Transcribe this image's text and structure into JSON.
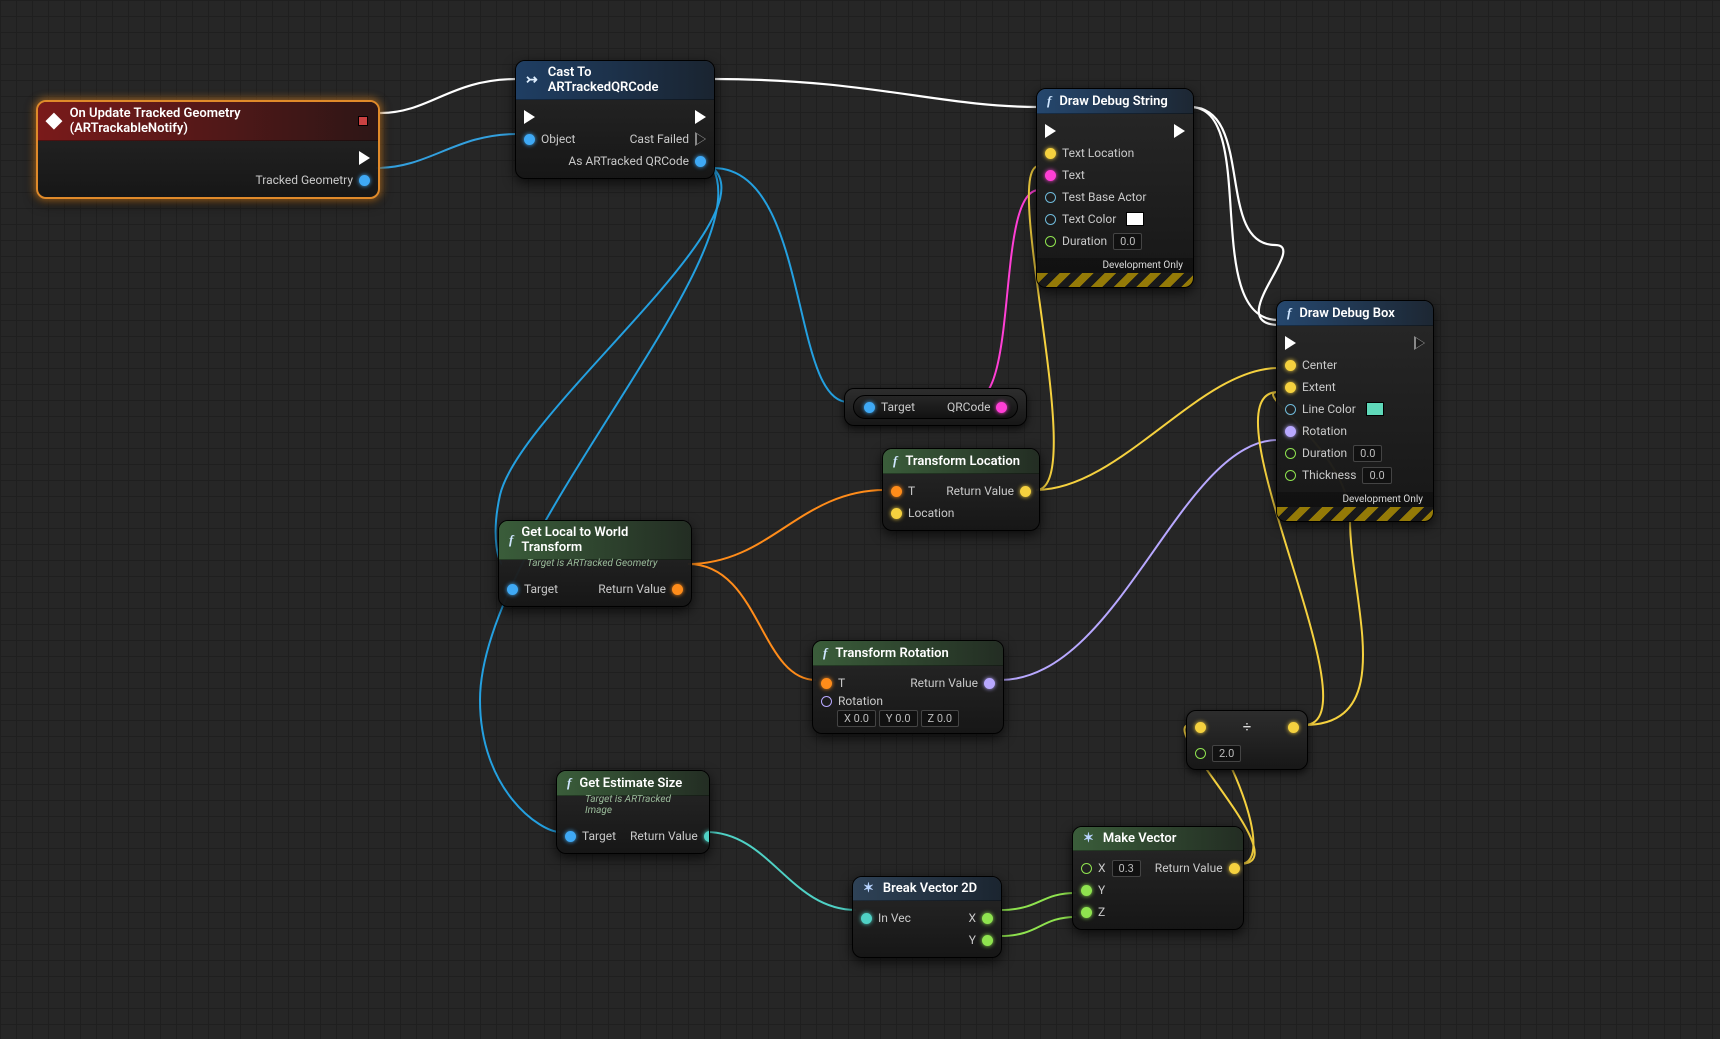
{
  "nodes": {
    "event": {
      "title": "On Update Tracked Geometry (ARTrackableNotify)",
      "out_geom": "Tracked Geometry"
    },
    "cast": {
      "title": "Cast To ARTrackedQRCode",
      "in_object": "Object",
      "out_fail": "Cast Failed",
      "out_as": "As ARTracked QRCode"
    },
    "drawString": {
      "title": "Draw Debug String",
      "in_textloc": "Text Location",
      "in_text": "Text",
      "in_testbase": "Test Base Actor",
      "in_textcolor": "Text Color",
      "in_duration": "Duration",
      "dur_val": "0.0",
      "dev": "Development Only"
    },
    "drawBox": {
      "title": "Draw Debug Box",
      "in_center": "Center",
      "in_extent": "Extent",
      "in_linecolor": "Line Color",
      "in_rotation": "Rotation",
      "in_duration": "Duration",
      "dur_val": "0.0",
      "in_thickness": "Thickness",
      "thick_val": "0.0",
      "dev": "Development Only"
    },
    "qrcode": {
      "in": "Target",
      "out": "QRCode"
    },
    "transLoc": {
      "title": "Transform Location",
      "in_t": "T",
      "in_loc": "Location",
      "out": "Return Value"
    },
    "local2world": {
      "title": "Get Local to World Transform",
      "sub": "Target is ARTracked Geometry",
      "in": "Target",
      "out": "Return Value"
    },
    "transRot": {
      "title": "Transform Rotation",
      "in_t": "T",
      "in_rot": "Rotation",
      "rx": "0.0",
      "ry": "0.0",
      "rz": "0.0",
      "out": "Return Value"
    },
    "estSize": {
      "title": "Get Estimate Size",
      "sub": "Target is ARTracked Image",
      "in": "Target",
      "out": "Return Value"
    },
    "breakVec": {
      "title": "Break Vector 2D",
      "in": "In Vec",
      "outx": "X",
      "outy": "Y"
    },
    "makeVec": {
      "title": "Make Vector",
      "in_x": "X",
      "xv": "0.3",
      "in_y": "Y",
      "in_z": "Z",
      "out": "Return Value"
    },
    "divide": {
      "val": "2.0"
    }
  },
  "labels": {
    "x": "X",
    "y": "Y",
    "z": "Z"
  }
}
